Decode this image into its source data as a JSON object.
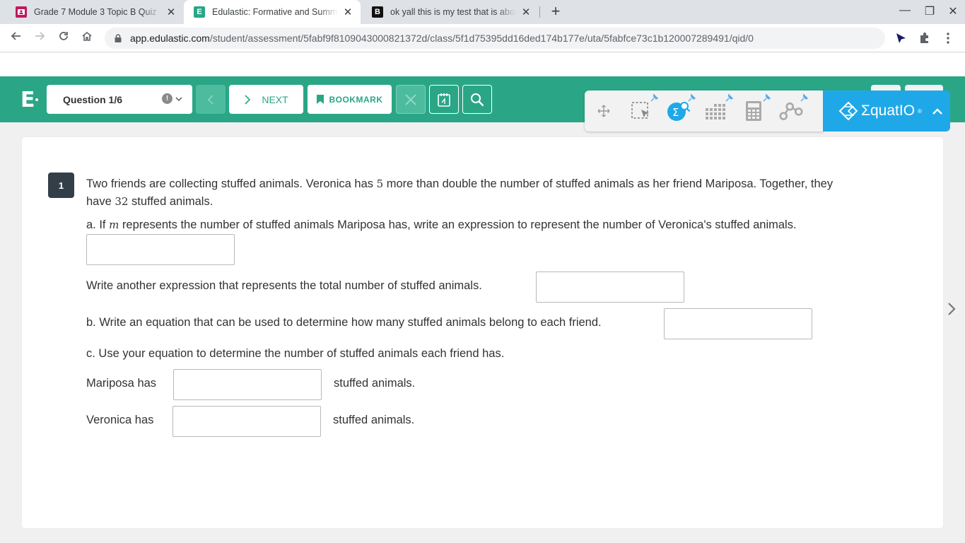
{
  "browser": {
    "tabs": [
      {
        "title": "Grade 7 Module 3 Topic B Quiz - I",
        "favicon_color": "#c2185b",
        "favicon_char": "■",
        "active": false
      },
      {
        "title": "Edulastic: Formative and Summa",
        "favicon_color": "#2aa687",
        "favicon_char": "E",
        "active": true
      },
      {
        "title": "ok yall this is my test that is abou",
        "favicon_color": "#111111",
        "favicon_char": "B",
        "active": false
      }
    ],
    "close_glyph": "✕",
    "new_tab_glyph": "+",
    "window_controls": {
      "minimize": "—",
      "restore": "❐",
      "close": "✕"
    },
    "url_host": "app.edulastic.com",
    "url_path": "/student/assessment/5fabf9f8109043000821372d/class/5f1d75395dd16ded174b177e/uta/5fabfce73c1b120007289491/qid/0"
  },
  "app": {
    "logo": "E",
    "question_select": "Question 1/6",
    "info_glyph": "!",
    "next_label": "NEXT",
    "bookmark_label": "BOOKMARK",
    "accent": "#2aa687"
  },
  "equatio": {
    "brand": "ΣquatIO",
    "reg": "®",
    "accent": "#1fa8e8"
  },
  "question": {
    "number": "1",
    "stem_line1_a": "Two friends are collecting stuffed animals.  Veronica has ",
    "stem_num1": "5",
    "stem_line1_b": " more than double the number of stuffed animals as her friend Mariposa.  Together, they",
    "stem_line2_a": "have ",
    "stem_num2": "32",
    "stem_line2_b": " stuffed animals.",
    "part_a_1": "a.  If ",
    "part_a_var": "m",
    "part_a_2": " represents the number of stuffed animals Mariposa has, write an expression to represent the number of Veronica's stuffed animals.",
    "part_a_followup": "Write another expression that represents the total number of stuffed animals.",
    "part_b": "b.  Write an equation that can be used to determine how many stuffed animals belong to each friend.",
    "part_c": "c.  Use your equation to determine the number of stuffed animals each friend has.",
    "mariposa_prefix": "Mariposa has",
    "veronica_prefix": "Veronica has",
    "suffix": "stuffed animals.",
    "answers": {
      "a1": "",
      "a2": "",
      "b": "",
      "mariposa": "",
      "veronica": ""
    }
  }
}
